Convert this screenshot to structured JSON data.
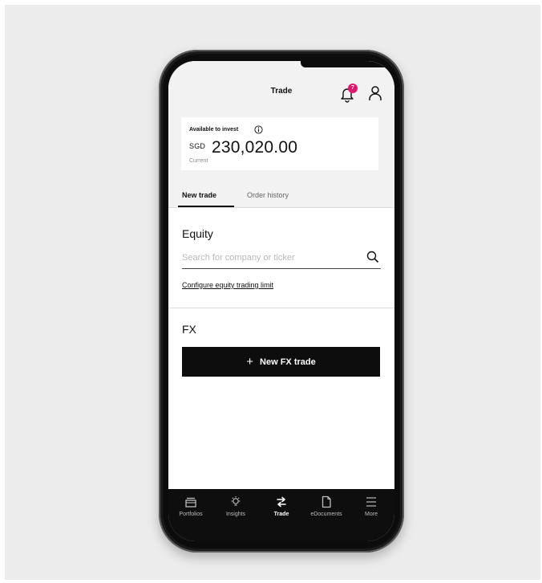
{
  "header": {
    "title": "Trade",
    "notification_count": "7"
  },
  "balance_card": {
    "label": "Available to invest",
    "currency": "SGD",
    "amount": "230,020.00",
    "status": "Current"
  },
  "tabs": [
    {
      "label": "New trade",
      "active": true
    },
    {
      "label": "Order history",
      "active": false
    }
  ],
  "equity": {
    "heading": "Equity",
    "search_placeholder": "Search for company or ticker",
    "configure_link": "Configure equity trading limit"
  },
  "fx": {
    "heading": "FX",
    "button_label": "New FX trade"
  },
  "bottom_nav": [
    {
      "label": "Portfolios",
      "icon": "portfolio-icon",
      "active": false
    },
    {
      "label": "Insights",
      "icon": "lightbulb-icon",
      "active": false
    },
    {
      "label": "Trade",
      "icon": "swap-arrows-icon",
      "active": true
    },
    {
      "label": "eDocuments",
      "icon": "document-icon",
      "active": false
    },
    {
      "label": "More",
      "icon": "menu-icon",
      "active": false
    }
  ],
  "colors": {
    "badge": "#e2156b",
    "primary_button": "#0d0d0d",
    "nav_background": "#0e0e0e",
    "page_background": "#ececec"
  }
}
